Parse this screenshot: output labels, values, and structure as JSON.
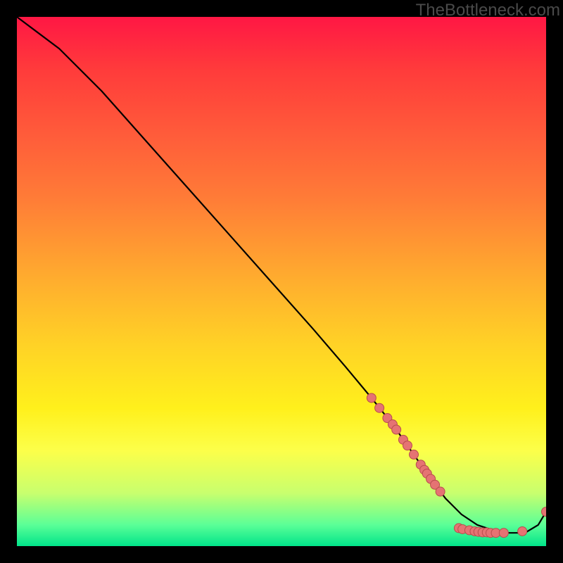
{
  "watermark": "TheBottleneck.com",
  "chart_data": {
    "type": "line",
    "title": "",
    "xlabel": "",
    "ylabel": "",
    "xlim": [
      0,
      100
    ],
    "ylim": [
      0,
      100
    ],
    "series": [
      {
        "name": "curve",
        "x": [
          0,
          4,
          8,
          16,
          24,
          32,
          40,
          48,
          56,
          62,
          67,
          71,
          74.5,
          78,
          81,
          84,
          87,
          90,
          93,
          96,
          98.5,
          100
        ],
        "y": [
          100,
          97,
          94,
          86,
          77,
          68,
          59,
          50,
          41,
          34,
          28,
          23,
          18,
          13,
          9,
          6,
          4,
          3,
          2.5,
          2.5,
          4,
          6.5
        ]
      }
    ],
    "markers": [
      {
        "x": 67.0,
        "y": 28.0
      },
      {
        "x": 68.5,
        "y": 26.1
      },
      {
        "x": 70.0,
        "y": 24.2
      },
      {
        "x": 71.0,
        "y": 23.0
      },
      {
        "x": 71.7,
        "y": 22.0
      },
      {
        "x": 73.0,
        "y": 20.1
      },
      {
        "x": 73.8,
        "y": 19.0
      },
      {
        "x": 75.0,
        "y": 17.3
      },
      {
        "x": 76.3,
        "y": 15.4
      },
      {
        "x": 77.0,
        "y": 14.4
      },
      {
        "x": 77.5,
        "y": 13.7
      },
      {
        "x": 78.2,
        "y": 12.7
      },
      {
        "x": 79.0,
        "y": 11.6
      },
      {
        "x": 80.0,
        "y": 10.3
      },
      {
        "x": 83.5,
        "y": 3.4
      },
      {
        "x": 84.2,
        "y": 3.2
      },
      {
        "x": 85.5,
        "y": 3.0
      },
      {
        "x": 86.5,
        "y": 2.8
      },
      {
        "x": 87.2,
        "y": 2.7
      },
      {
        "x": 88.0,
        "y": 2.6
      },
      {
        "x": 88.8,
        "y": 2.6
      },
      {
        "x": 89.5,
        "y": 2.5
      },
      {
        "x": 90.5,
        "y": 2.5
      },
      {
        "x": 92.0,
        "y": 2.5
      },
      {
        "x": 95.5,
        "y": 2.8
      },
      {
        "x": 100.0,
        "y": 6.5
      }
    ],
    "colors": {
      "line": "#000000",
      "marker_fill": "#e57373",
      "marker_stroke": "#b84d4d"
    }
  }
}
